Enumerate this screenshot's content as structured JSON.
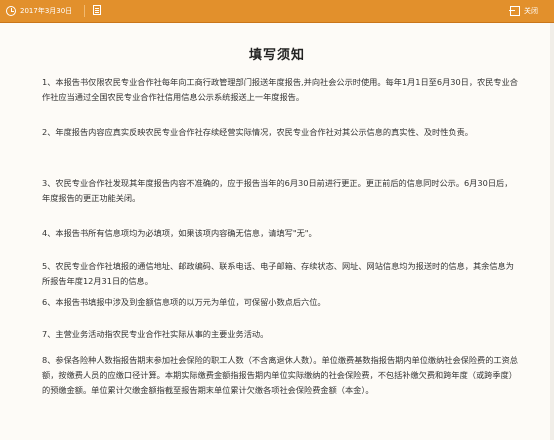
{
  "topbar": {
    "date": "2017年3月30日",
    "close_label": "关闭"
  },
  "document": {
    "title": "填写须知",
    "items": [
      "1、本报告书仅限农民专业合作社每年向工商行政管理部门报送年度报告,并向社会公示时使用。每年1月1日至6月30日，农民专业合作社应当通过全国农民专业合作社信用信息公示系统报送上一年度报告。",
      "2、年度报告内容应真实反映农民专业合作社存续经营实际情况，农民专业合作社对其公示信息的真实性、及时性负责。",
      "3、农民专业合作社发现其年度报告内容不准确的，应于报告当年的6月30日前进行更正。更正前后的信息同时公示。6月30日后，年度报告的更正功能关闭。",
      "4、本报告书所有信息项均为必填项，如果该项内容确无信息，请填写\"无\"。",
      "5、农民专业合作社填报的通信地址、邮政编码、联系电话、电子邮箱、存续状态、网址、网站信息均为报送时的信息，其余信息为所报告年度12月31日的信息。",
      "6、本报告书填报中涉及到金额信息项的以万元为单位，可保留小数点后六位。",
      "7、主营业务活动指农民专业合作社实际从事的主要业务活动。",
      "8、参保各险种人数指报告期末参加社会保险的职工人数（不含离退休人数）。单位缴费基数指报告期内单位缴纳社会保险费的工资总额，按缴费人员的应缴口径计算。本期实际缴费金额指报告期内单位实际缴纳的社会保险费，不包括补缴欠费和跨年度（或跨季度）的预缴金额。单位累计欠缴金额指截至报告期末单位累计欠缴各项社会保险费金额（本金）。"
    ]
  }
}
